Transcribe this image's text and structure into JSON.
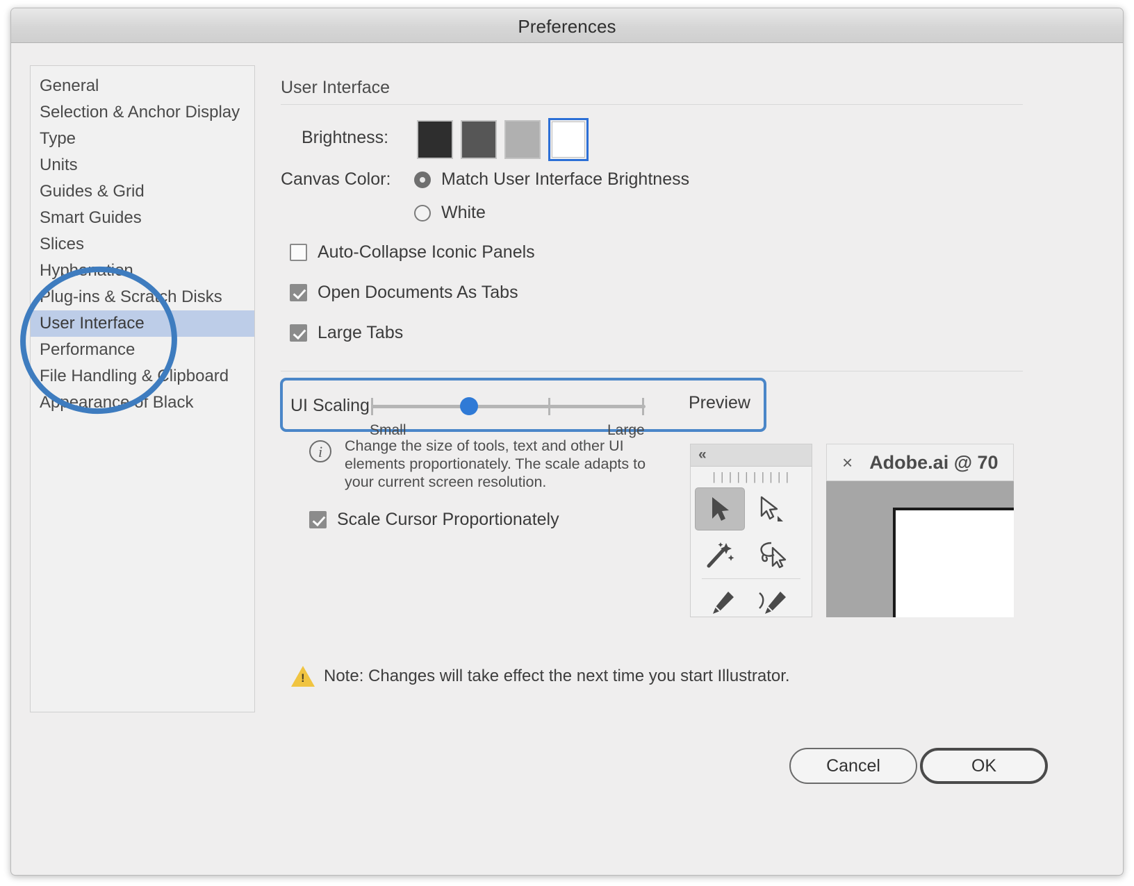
{
  "window": {
    "title": "Preferences"
  },
  "sidebar": {
    "items": [
      {
        "label": "General",
        "selected": false
      },
      {
        "label": "Selection & Anchor Display",
        "selected": false
      },
      {
        "label": "Type",
        "selected": false
      },
      {
        "label": "Units",
        "selected": false
      },
      {
        "label": "Guides & Grid",
        "selected": false
      },
      {
        "label": "Smart Guides",
        "selected": false
      },
      {
        "label": "Slices",
        "selected": false
      },
      {
        "label": "Hyphenation",
        "selected": false
      },
      {
        "label": "Plug-ins & Scratch Disks",
        "selected": false
      },
      {
        "label": "User Interface",
        "selected": true
      },
      {
        "label": "Performance",
        "selected": false
      },
      {
        "label": "File Handling & Clipboard",
        "selected": false
      },
      {
        "label": "Appearance of Black",
        "selected": false
      }
    ]
  },
  "main": {
    "section_title": "User Interface",
    "brightness": {
      "label": "Brightness:",
      "swatches": [
        {
          "name": "darkest",
          "color": "#2e2e2e",
          "selected": false
        },
        {
          "name": "dark",
          "color": "#565656",
          "selected": false
        },
        {
          "name": "light",
          "color": "#b0b0b0",
          "selected": false
        },
        {
          "name": "lightest",
          "color": "#ffffff",
          "selected": true
        }
      ],
      "selection_color": "#2c6fd6"
    },
    "canvas_color": {
      "label": "Canvas Color:",
      "options": [
        {
          "label": "Match User Interface Brightness",
          "selected": true
        },
        {
          "label": "White",
          "selected": false
        }
      ]
    },
    "checkboxes": [
      {
        "label": "Auto-Collapse Iconic Panels",
        "checked": false
      },
      {
        "label": "Open Documents As Tabs",
        "checked": true
      },
      {
        "label": "Large Tabs",
        "checked": true
      }
    ],
    "ui_scaling": {
      "label": "UI Scaling:",
      "small_label": "Small",
      "large_label": "Large",
      "preview_label": "Preview",
      "value_percent": 33,
      "highlight_color": "#4a86c8",
      "knob_color": "#2f7ad6",
      "info_icon": "info-icon",
      "info_text": "Change the size of tools, text and other UI elements proportionately. The scale adapts to your current screen resolution.",
      "scale_cursor": {
        "label": "Scale Cursor Proportionately",
        "checked": true
      }
    },
    "preview_mock": {
      "toolbar_collapse": "«",
      "document_close": "×",
      "document_title": "Adobe.ai @ 70"
    },
    "note": {
      "icon": "warning-icon",
      "text": "Note:  Changes will take effect the next time you start Illustrator."
    }
  },
  "footer": {
    "cancel_label": "Cancel",
    "ok_label": "OK"
  },
  "annotation": {
    "shape": "hand-drawn-circle",
    "color": "#3e7cbf",
    "targets": "User Interface"
  }
}
